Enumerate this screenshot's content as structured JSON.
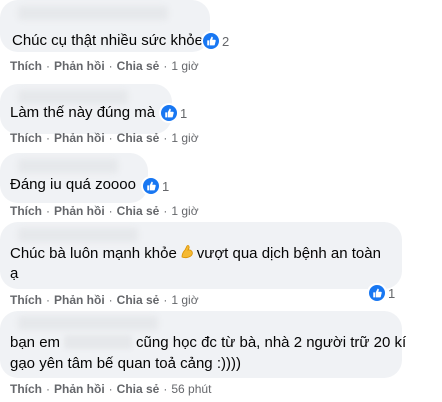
{
  "comments": [
    {
      "text": "Chúc cụ thật nhiều sức khỏe",
      "reactions": "2",
      "actions": [
        "Thích",
        "Phản hồi",
        "Chia sẻ"
      ],
      "time": "1 giờ"
    },
    {
      "text": "Làm thế này đúng mà",
      "reactions": "1",
      "actions": [
        "Thích",
        "Phản hồi",
        "Chia sẻ"
      ],
      "time": "1 giờ"
    },
    {
      "text": "Đáng iu quá zoooo",
      "reactions": "1",
      "actions": [
        "Thích",
        "Phản hồi",
        "Chia sẻ"
      ],
      "time": "1 giờ"
    },
    {
      "text_before": "Chúc bà luôn mạnh khỏe",
      "emoji": "flexed-biceps",
      "text_after": "vượt qua dịch bệnh an toàn",
      "text_line2": "ạ",
      "reactions": "1",
      "actions": [
        "Thích",
        "Phản hồi",
        "Chia sẻ"
      ],
      "time": "1 giờ"
    },
    {
      "text_before": "bạn em",
      "text_after": "cũng học đc từ bà, nhà 2 người trữ 20 kí",
      "text_line2": "gạo yên tâm bế quan toả cảng :))))",
      "actions": [
        "Thích",
        "Phản hồi",
        "Chia sẻ"
      ],
      "time": "56 phút"
    }
  ],
  "separator": "·",
  "colors": {
    "bubble": "#f0f2f5",
    "like_blue": "#1877f2",
    "meta_gray": "#65676b"
  }
}
